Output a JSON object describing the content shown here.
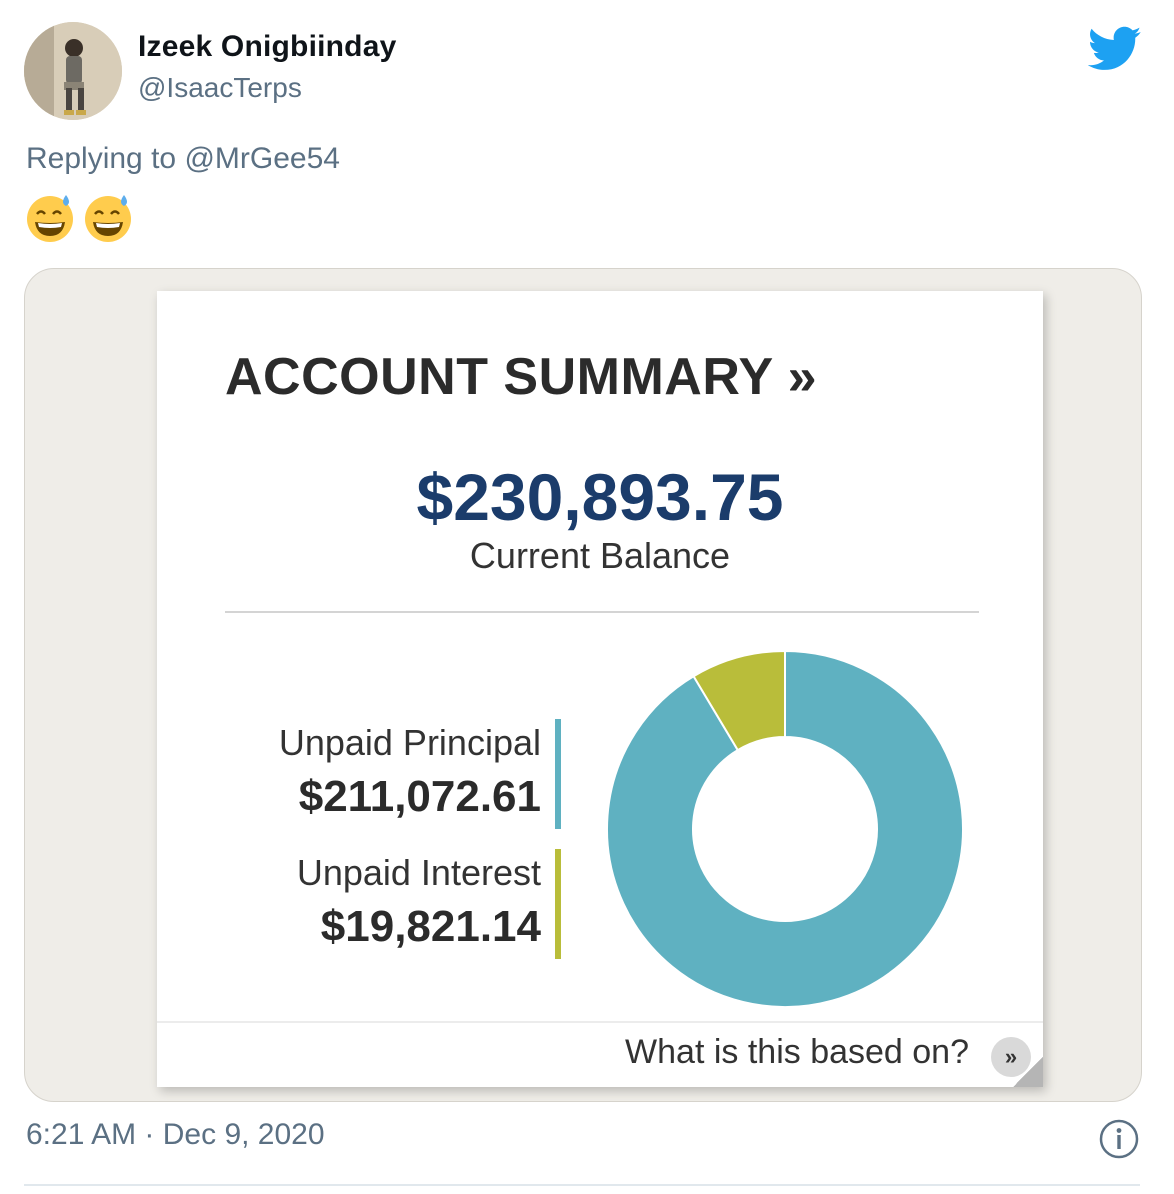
{
  "tweet": {
    "author_name": "Izeek Onigbiinday",
    "author_handle": "@IsaacTerps",
    "reply_prefix": "Replying to ",
    "reply_mention": "@MrGee54",
    "emojis": [
      "grinning-face-with-sweat-emoji",
      "grinning-face-with-sweat-emoji"
    ],
    "time": "6:21 AM",
    "separator": "·",
    "date": "Dec 9, 2020",
    "brand_color": "#1da1f2"
  },
  "card": {
    "title": "ACCOUNT SUMMARY »",
    "balance": "$230,893.75",
    "balance_label": "Current Balance",
    "principal_label": "Unpaid Principal",
    "principal_value": "$211,072.61",
    "interest_label": "Unpaid Interest",
    "interest_value": "$19,821.14",
    "footer_link": "What is this based on?",
    "footer_button": "»",
    "balance_color": "#1b3c6b"
  },
  "chart_data": {
    "type": "pie",
    "categories": [
      "Unpaid Principal",
      "Unpaid Interest"
    ],
    "values": [
      211072.61,
      19821.14
    ],
    "colors": [
      "#5fb1c1",
      "#b9bd3a"
    ],
    "donut": true
  }
}
